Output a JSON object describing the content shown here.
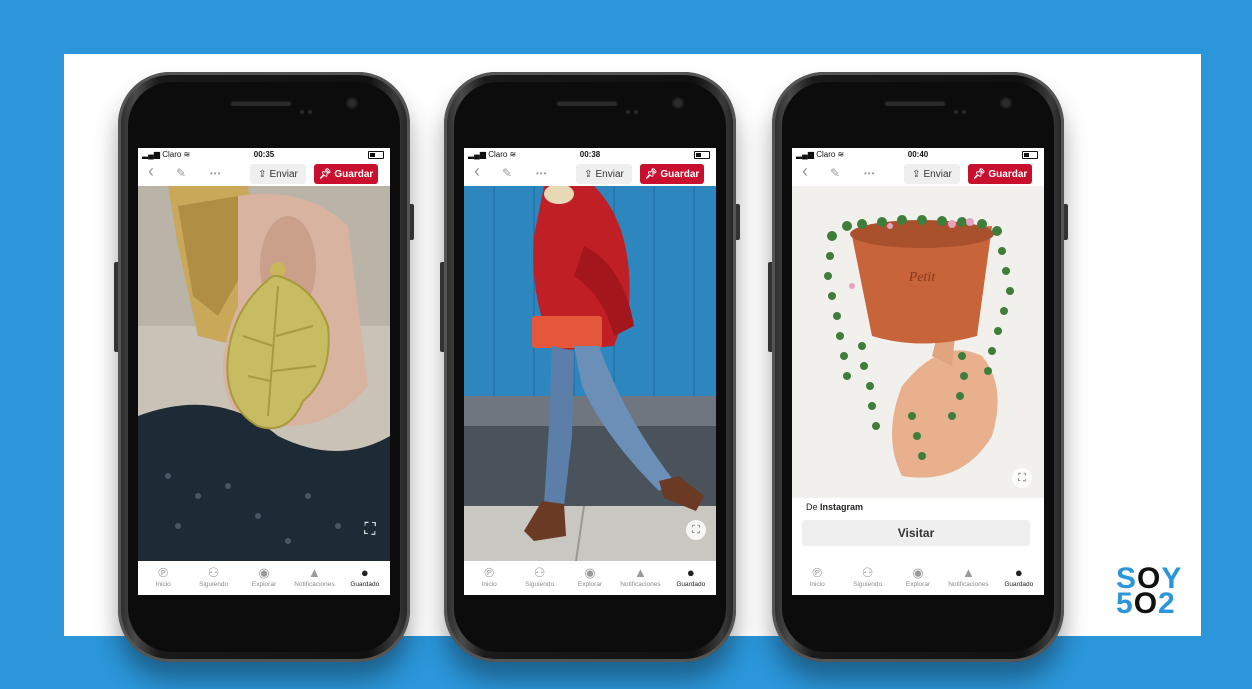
{
  "phones": [
    {
      "status": {
        "carrier": "Claro",
        "time": "00:35"
      },
      "toolbar": {
        "back": "‹",
        "edit": "✎",
        "more": "•••",
        "send_label": "Enviar",
        "save_label": "Guardar"
      },
      "pin": {
        "subject": "leaf-earring-photo"
      }
    },
    {
      "status": {
        "carrier": "Claro",
        "time": "00:38"
      },
      "toolbar": {
        "back": "‹",
        "edit": "✎",
        "more": "•••",
        "send_label": "Enviar",
        "save_label": "Guardar"
      },
      "pin": {
        "subject": "red-sweater-street-photo"
      }
    },
    {
      "status": {
        "carrier": "Claro",
        "time": "00:40"
      },
      "toolbar": {
        "back": "‹",
        "edit": "✎",
        "more": "•••",
        "send_label": "Enviar",
        "save_label": "Guardar"
      },
      "pin": {
        "subject": "succulent-pot-photo",
        "source_prefix": "De",
        "source_name": "Instagram",
        "visit_label": "Visitar"
      }
    }
  ],
  "tabs": [
    {
      "label": "Inicio",
      "icon": "pinterest-icon"
    },
    {
      "label": "Siguiendo",
      "icon": "people-icon"
    },
    {
      "label": "Explorar",
      "icon": "compass-icon"
    },
    {
      "label": "Notificaciones",
      "icon": "bell-icon"
    },
    {
      "label": "Guardado",
      "icon": "person-icon"
    }
  ],
  "brand": {
    "line1_a": "S",
    "line1_b": "O",
    "line1_c": "Y",
    "line2_a": "5",
    "line2_b": "O",
    "line2_c": "2",
    "accent": "#2b96d9"
  },
  "colors": {
    "background": "#2b96d9",
    "save_button": "#c8102e"
  }
}
